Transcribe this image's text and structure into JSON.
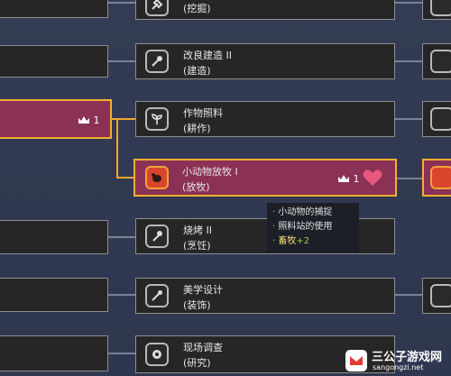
{
  "nodes": [
    {
      "title": "",
      "category": "(挖掘)",
      "icon": "shovel-icon"
    },
    {
      "title": "改良建造 II",
      "category": "(建造)",
      "icon": "hammer-icon"
    },
    {
      "title": "作物照料",
      "category": "(耕作)",
      "icon": "sprout-icon"
    },
    {
      "title": "小动物放牧 I",
      "category": "(放牧)",
      "icon": "animal-icon",
      "count": "1",
      "selected": true
    },
    {
      "title": "烧烤 II",
      "category": "(烹饪)",
      "icon": "flame-icon"
    },
    {
      "title": "美学设计",
      "category": "(装饰)",
      "icon": "brush-icon"
    },
    {
      "title": "现场调查",
      "category": "(研究)",
      "icon": "magnifier-icon"
    }
  ],
  "left_node": {
    "count": "1"
  },
  "tooltip": {
    "lines": [
      "小动物的捕捉",
      "照料站的使用"
    ],
    "bonus_label": "畜牧",
    "bonus_value": "+2"
  },
  "watermark": {
    "title": "三公子游戏网",
    "url": "sangongzi.net"
  },
  "colors": {
    "selected_border": "#f3b02e",
    "selected_fill": "#8b3156",
    "heart": "#e8577e",
    "bonus": "#9cd34e"
  }
}
